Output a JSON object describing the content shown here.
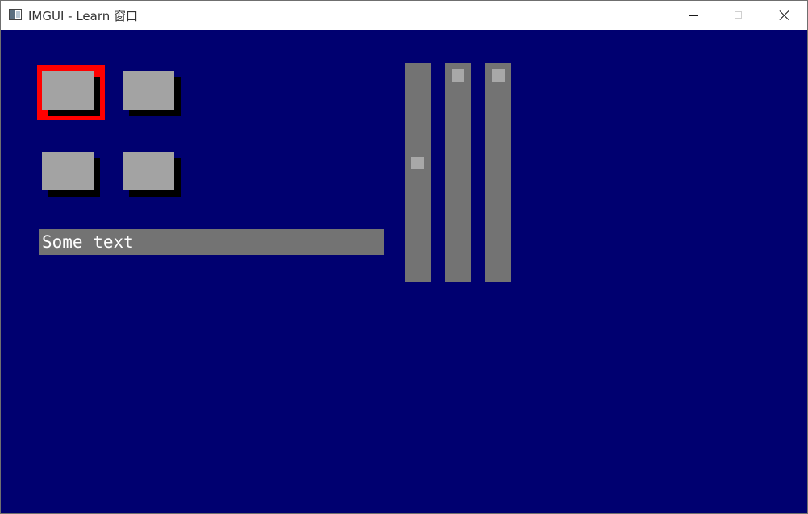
{
  "window": {
    "title": "IMGUI - Learn 窗口",
    "minimize_symbol": "–",
    "maximize_symbol": "□",
    "close_symbol": "×",
    "icon": "app-window-icon"
  },
  "colors": {
    "background": "#000070",
    "button": "#a3a3a3",
    "button_shadow": "#000000",
    "focus_highlight": "#ff0000",
    "text_field": "#737373",
    "slider_track": "#737373",
    "slider_thumb": "#a8a8a8",
    "text": "#ffffff"
  },
  "buttons": [
    {
      "id": "button-1",
      "label": "",
      "focused": true
    },
    {
      "id": "button-2",
      "label": "",
      "focused": false
    },
    {
      "id": "button-3",
      "label": "",
      "focused": false
    },
    {
      "id": "button-4",
      "label": "",
      "focused": false
    }
  ],
  "text_field": {
    "value": "Some text"
  },
  "sliders": [
    {
      "id": "slider-1",
      "orientation": "vertical",
      "value_fraction": 0.45
    },
    {
      "id": "slider-2",
      "orientation": "vertical",
      "value_fraction": 0.0
    },
    {
      "id": "slider-3",
      "orientation": "vertical",
      "value_fraction": 0.0
    }
  ]
}
